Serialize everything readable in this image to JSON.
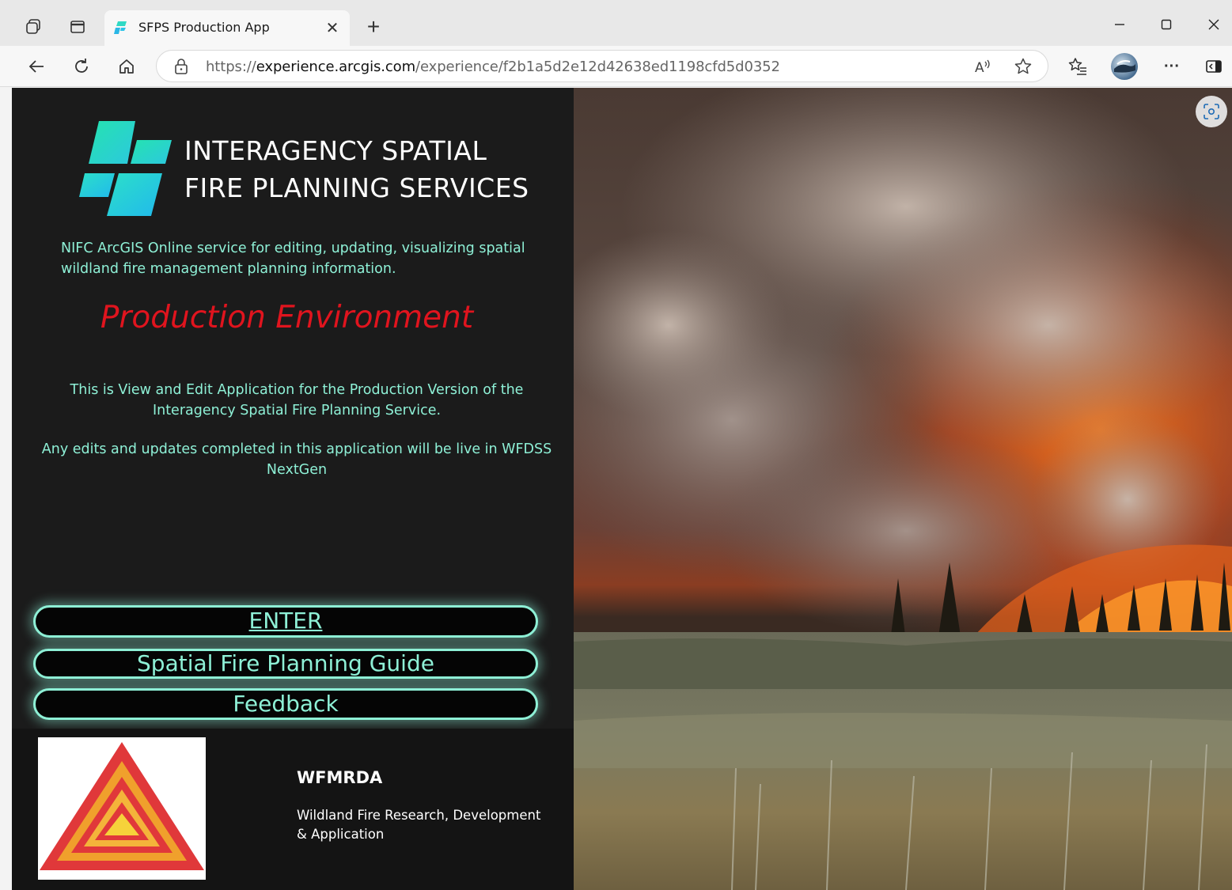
{
  "browser": {
    "tab_title": "SFPS Production App",
    "url_protocol": "https://",
    "url_host": "experience.arcgis.com",
    "url_path": "/experience/f2b1a5d2e12d42638ed1198cfd5d0352",
    "icons": [
      "workspaces-icon",
      "tab-actions-icon",
      "app-favicon",
      "close-tab-icon",
      "new-tab-icon",
      "minimize-icon",
      "maximize-icon",
      "close-window-icon",
      "back-icon",
      "refresh-icon",
      "home-icon",
      "site-info-icon",
      "read-aloud-icon",
      "favorite-star-icon",
      "favorites-icon",
      "profile-avatar",
      "more-menu-icon",
      "sidebar-toggle-icon",
      "screenshot-icon"
    ],
    "more_label": "···"
  },
  "page": {
    "logo_line1": "INTERAGENCY SPATIAL",
    "logo_line2": "FIRE PLANNING SERVICES",
    "intro": "NIFC ArcGIS Online service for editing, updating, visualizing spatial wildland fire management planning information.",
    "environment": "Production Environment",
    "description1": "This is View and Edit Application for the Production Version of the Interagency Spatial Fire Planning Service.",
    "description2": "Any edits and updates completed in this application will be live in WFDSS NextGen",
    "buttons": {
      "enter": "ENTER",
      "guide": "Spatial Fire Planning Guide",
      "feedback": "Feedback"
    },
    "footer": {
      "title": "WFMRDA",
      "subtitle": "Wildland Fire Research, Development & Application"
    }
  },
  "colors": {
    "accent": "#8ef0d6",
    "environment": "#e0141e",
    "panel_bg": "#1b1b1b"
  }
}
